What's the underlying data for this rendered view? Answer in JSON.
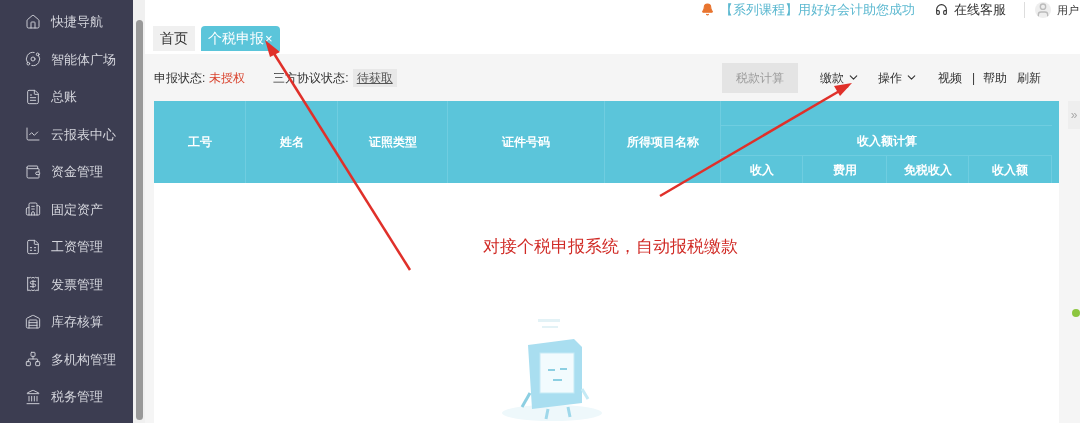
{
  "sidebar": {
    "items": [
      {
        "label": "快捷导航"
      },
      {
        "label": "智能体广场"
      },
      {
        "label": "总账"
      },
      {
        "label": "云报表中心"
      },
      {
        "label": "资金管理"
      },
      {
        "label": "固定资产"
      },
      {
        "label": "工资管理"
      },
      {
        "label": "发票管理"
      },
      {
        "label": "库存核算"
      },
      {
        "label": "多机构管理"
      },
      {
        "label": "税务管理"
      }
    ]
  },
  "top_bar": {
    "notice": "【系列课程】用好好会计助您成功",
    "service": "在线客服",
    "user": "用户"
  },
  "tabs": [
    {
      "label": "首页",
      "selected": false
    },
    {
      "label": "个税申报",
      "selected": true,
      "close": "×"
    }
  ],
  "status_row": {
    "declare_label": "申报状态:",
    "declare_value": "未授权",
    "agreement_label": "三方协议状态:",
    "agreement_value": "待获取"
  },
  "toolbar": [
    {
      "kind": "button",
      "label": "税款计算",
      "disabled": true
    },
    {
      "kind": "dropdown",
      "label": "缴款"
    },
    {
      "kind": "dropdown",
      "label": "操作"
    },
    {
      "kind": "link",
      "label": "视频"
    },
    {
      "kind": "separator",
      "label": "|"
    },
    {
      "kind": "link",
      "label": "帮助"
    },
    {
      "kind": "link",
      "label": "刷新"
    }
  ],
  "table": {
    "columns": [
      "工号",
      "姓名",
      "证照类型",
      "证件号码",
      "所得项目名称"
    ],
    "group": {
      "label": "收入额计算",
      "columns": [
        "收入",
        "费用",
        "免税收入",
        "收入额"
      ]
    }
  },
  "collapse_handle": "»",
  "annotation": {
    "text": "对接个税申报系统，自动报税缴款"
  }
}
